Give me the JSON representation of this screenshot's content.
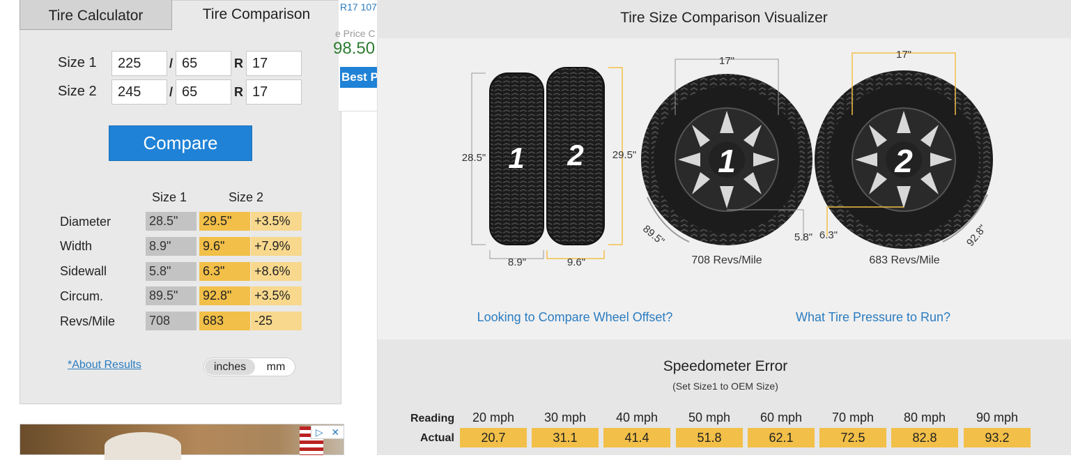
{
  "tabs": {
    "calculator": "Tire Calculator",
    "comparison": "Tire Comparison"
  },
  "sizes": [
    {
      "label": "Size 1",
      "width": "225",
      "ratio": "65",
      "rim": "17"
    },
    {
      "label": "Size 2",
      "width": "245",
      "ratio": "65",
      "rim": "17"
    }
  ],
  "separators": {
    "slash": "/",
    "rim_prefix": "R"
  },
  "compare_button": "Compare",
  "results": {
    "headers": [
      "Size 1",
      "Size 2"
    ],
    "rows": [
      {
        "label": "Diameter",
        "size1": "28.5\"",
        "size2": "29.5\"",
        "diff": "+3.5%"
      },
      {
        "label": "Width",
        "size1": "8.9\"",
        "size2": "9.6\"",
        "diff": "+7.9%"
      },
      {
        "label": "Sidewall",
        "size1": "5.8\"",
        "size2": "6.3\"",
        "diff": "+8.6%"
      },
      {
        "label": "Circum.",
        "size1": "89.5\"",
        "size2": "92.8\"",
        "diff": "+3.5%"
      },
      {
        "label": "Revs/Mile",
        "size1": "708",
        "size2": "683",
        "diff": "-25"
      }
    ]
  },
  "about_link": "*About Results",
  "units": {
    "inches": "inches",
    "mm": "mm",
    "selected": "inches"
  },
  "ad": {
    "badge_play": "▷",
    "badge_close": "✕"
  },
  "product_snippet": {
    "name": "R17 107",
    "price_label": "e Price C",
    "price": "98.50",
    "button": "Best P"
  },
  "visualizer": {
    "title": "Tire Size Comparison Visualizer",
    "tire1": {
      "number": "1",
      "diameter": "28.5\"",
      "width": "8.9\"",
      "rim": "17\"",
      "sidewall": "5.8\"",
      "circumference": "89.5\"",
      "revs": "708 Revs/Mile"
    },
    "tire2": {
      "number": "2",
      "diameter": "29.5\"",
      "width": "9.6\"",
      "rim": "17\"",
      "sidewall": "6.3\"",
      "circumference": "92.8\"",
      "revs": "683 Revs/Mile"
    },
    "links": {
      "offset": "Looking to Compare Wheel Offset?",
      "pressure": "What Tire Pressure to Run?"
    }
  },
  "speedometer": {
    "title": "Speedometer Error",
    "subtitle": "(Set Size1 to OEM Size)",
    "reading_label": "Reading",
    "actual_label": "Actual",
    "readings": [
      "20 mph",
      "30 mph",
      "40 mph",
      "50 mph",
      "60 mph",
      "70 mph",
      "80 mph",
      "90 mph"
    ],
    "actuals": [
      "20.7",
      "31.1",
      "41.4",
      "51.8",
      "62.1",
      "72.5",
      "82.8",
      "93.2"
    ]
  },
  "colors": {
    "accent_blue": "#1f82d6",
    "size2_orange": "#f2bf48",
    "diff_orange": "#f7d88d",
    "size1_gray": "#c3c3c3",
    "dimension_line": "#f2bf48"
  }
}
